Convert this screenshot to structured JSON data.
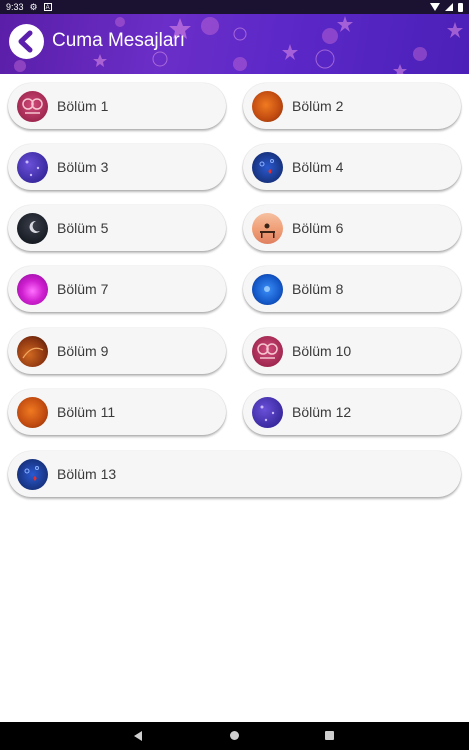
{
  "status_bar": {
    "time": "9:33"
  },
  "header": {
    "title": "Cuma Mesajları"
  },
  "items": [
    {
      "label": "Bölüm 1",
      "thumb": "rose-lanterns"
    },
    {
      "label": "Bölüm 2",
      "thumb": "orange-glow"
    },
    {
      "label": "Bölüm 3",
      "thumb": "purple-stars"
    },
    {
      "label": "Bölüm 4",
      "thumb": "blue-hearts"
    },
    {
      "label": "Bölüm 5",
      "thumb": "night-moon"
    },
    {
      "label": "Bölüm 6",
      "thumb": "sunset-bench"
    },
    {
      "label": "Bölüm 7",
      "thumb": "magenta-light"
    },
    {
      "label": "Bölüm 8",
      "thumb": "blue-sparkle"
    },
    {
      "label": "Bölüm 9",
      "thumb": "amber-swirl"
    },
    {
      "label": "Bölüm 10",
      "thumb": "rose-lanterns"
    },
    {
      "label": "Bölüm 11",
      "thumb": "orange-glow"
    },
    {
      "label": "Bölüm 12",
      "thumb": "purple-stars"
    },
    {
      "label": "Bölüm 13",
      "thumb": "blue-hearts"
    }
  ]
}
